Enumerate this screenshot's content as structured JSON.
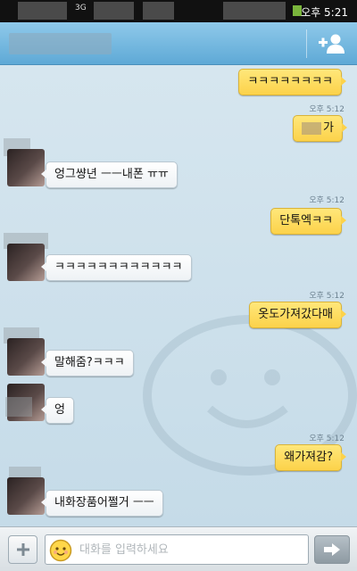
{
  "status_bar": {
    "time": "오후 5:21",
    "network": "3G"
  },
  "header": {
    "chat_name": "",
    "add_friend_icon": "add-person-icon"
  },
  "messages": [
    {
      "dir": "out",
      "text": "ㅋㅋㅋㅋㅋㅋㅋㅋ",
      "time": ""
    },
    {
      "dir": "out",
      "text": "가",
      "time": "오후 5:12"
    },
    {
      "dir": "in",
      "text": "엉그썅년 ㅡㅡ내폰 ㅠㅠ",
      "time": ""
    },
    {
      "dir": "out",
      "text": "단톡엑ㅋㅋ",
      "time": "오후 5:12"
    },
    {
      "dir": "in",
      "text": "ㅋㅋㅋㅋㅋㅋㅋㅋㅋㅋㅋㅋ",
      "time": ""
    },
    {
      "dir": "out",
      "text": "옷도가져갔다매",
      "time": "오후 5:12"
    },
    {
      "dir": "in",
      "text": "말해줌?ㅋㅋㅋ",
      "time": ""
    },
    {
      "dir": "in",
      "text": "엉",
      "time": ""
    },
    {
      "dir": "out",
      "text": "왜가져감?",
      "time": "오후 5:12"
    },
    {
      "dir": "in",
      "text": "내화장품어쩔거 ㅡㅡ",
      "time": ""
    }
  ],
  "composer": {
    "placeholder": "대화를 입력하세요",
    "value": ""
  },
  "colors": {
    "header": "#5ea9d6",
    "bubble_out": "#fcd24a",
    "bubble_in": "#ffffff",
    "chat_bg": "#c9dde9"
  }
}
